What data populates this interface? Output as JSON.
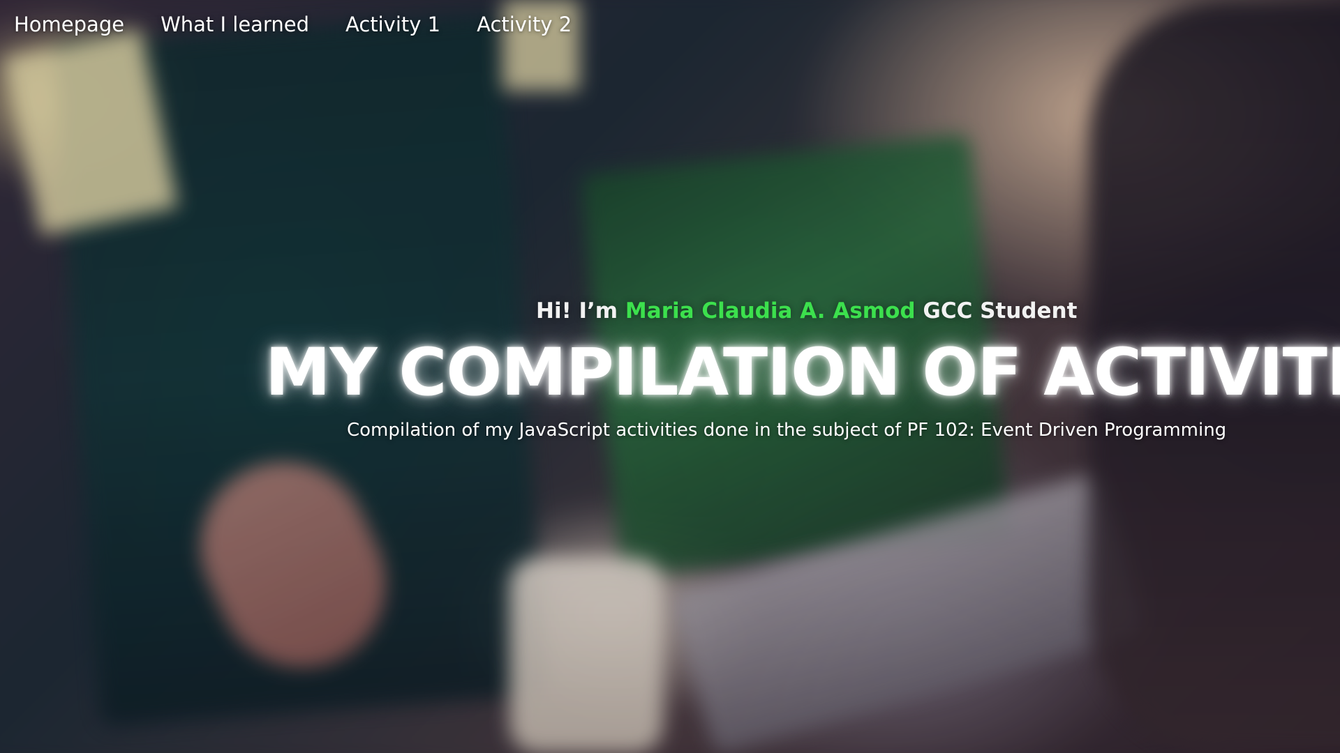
{
  "nav": {
    "items": [
      {
        "label": "Homepage"
      },
      {
        "label": "What I learned"
      },
      {
        "label": "Activity 1"
      },
      {
        "label": "Activity 2"
      }
    ]
  },
  "hero": {
    "greeting_prefix": "Hi! I’m",
    "name": "Maria Claudia A. Asmod",
    "greeting_suffix": "GCC Student",
    "title": "MY COMPILATION OF ACTIVITIES",
    "subtitle": "Compilation of my JavaScript activities done in the subject of PF 102: Event Driven Programming"
  },
  "colors": {
    "name_accent": "#3ce04d",
    "text": "#ffffff"
  }
}
